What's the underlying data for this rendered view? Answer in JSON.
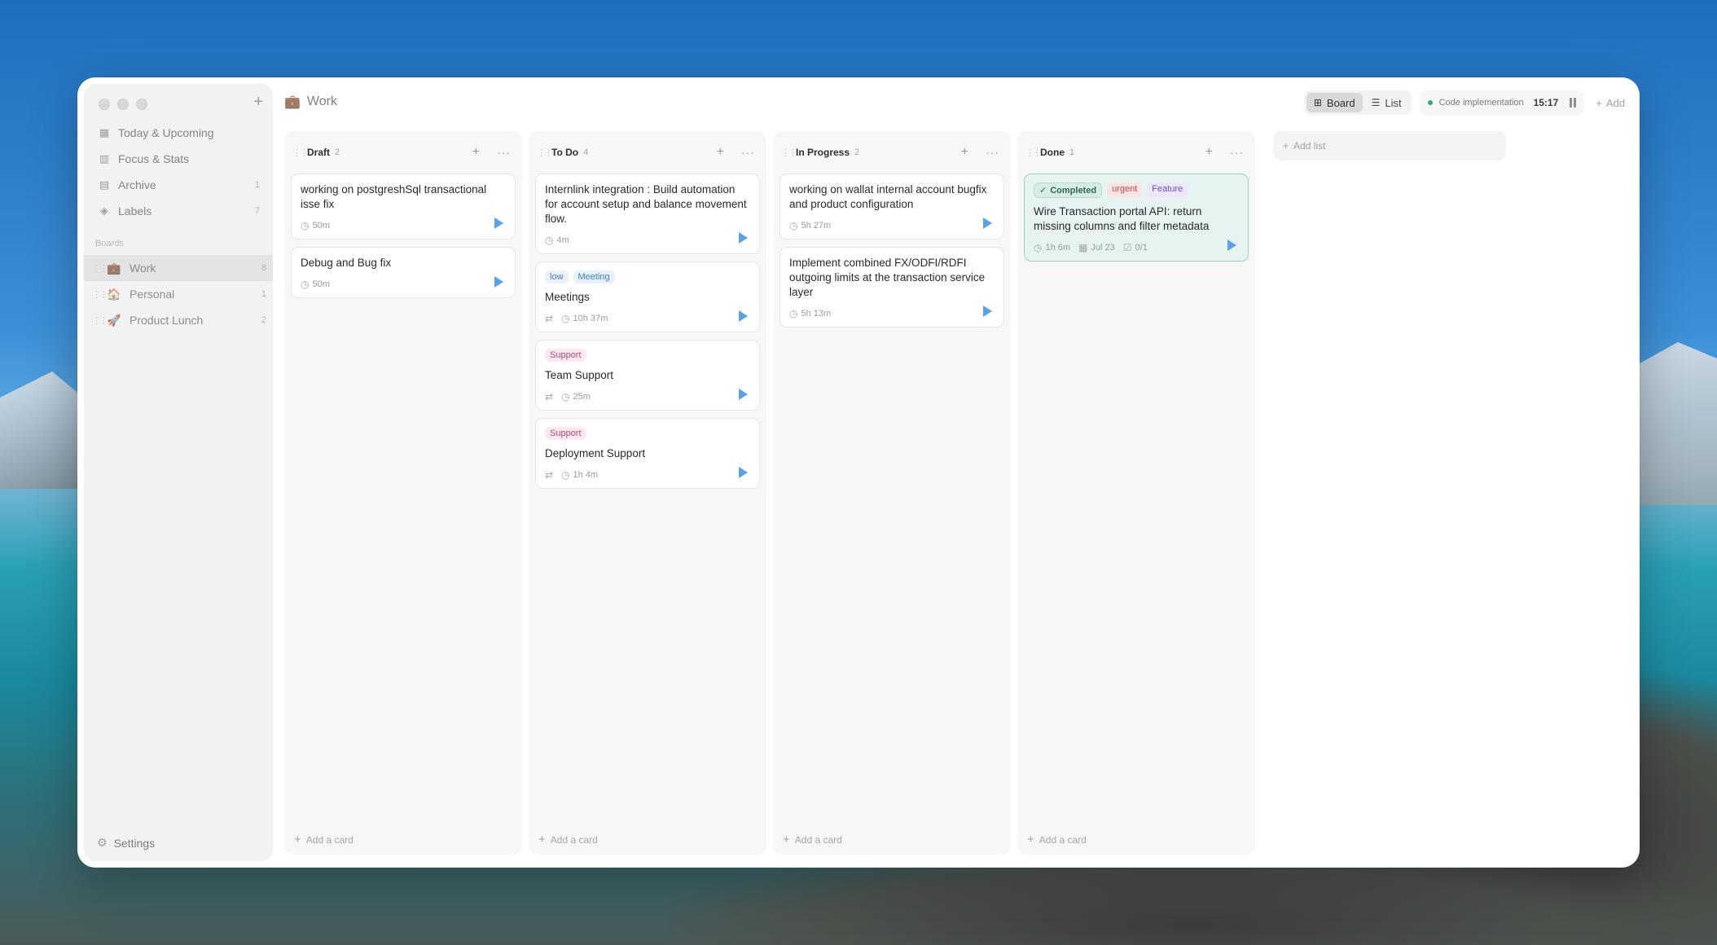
{
  "window": {
    "board_title": "Work",
    "board_emoji": "💼"
  },
  "sidebar": {
    "nav": [
      {
        "label": "Today & Upcoming",
        "icon": "calendar-icon",
        "count": ""
      },
      {
        "label": "Focus & Stats",
        "icon": "chart-icon",
        "count": ""
      },
      {
        "label": "Archive",
        "icon": "archive-icon",
        "count": "1"
      },
      {
        "label": "Labels",
        "icon": "tag-icon",
        "count": "7"
      }
    ],
    "boards_label": "Boards",
    "boards": [
      {
        "label": "Work",
        "emoji": "💼",
        "count": "8",
        "active": true
      },
      {
        "label": "Personal",
        "emoji": "🏠",
        "count": "1",
        "active": false
      },
      {
        "label": "Product Lunch",
        "emoji": "🚀",
        "count": "2",
        "active": false
      }
    ],
    "settings_label": "Settings"
  },
  "toolbar": {
    "board_label": "Board",
    "list_label": "List",
    "timer_task": "Code implementation",
    "timer_time": "15:17",
    "add_label": "Add"
  },
  "lists": [
    {
      "name": "Draft",
      "count": "2",
      "add_card": "Add a card",
      "cards": [
        {
          "title": "working on postgreshSql transactional isse fix",
          "time": "50m",
          "repeat": false,
          "tags": []
        },
        {
          "title": "Debug and Bug fix",
          "time": "50m",
          "repeat": false,
          "tags": []
        }
      ]
    },
    {
      "name": "To Do",
      "count": "4",
      "add_card": "Add a card",
      "cards": [
        {
          "title": "Internlink integration : Build automation for account setup and balance movement flow.",
          "time": "4m",
          "repeat": false,
          "tags": []
        },
        {
          "title": "Meetings",
          "time": "10h 37m",
          "repeat": true,
          "tags": [
            {
              "label": "low",
              "kind": "low"
            },
            {
              "label": "Meeting",
              "kind": "meeting"
            }
          ]
        },
        {
          "title": "Team Support",
          "time": "25m",
          "repeat": true,
          "tags": [
            {
              "label": "Support",
              "kind": "support"
            }
          ]
        },
        {
          "title": "Deployment Support",
          "time": "1h 4m",
          "repeat": true,
          "tags": [
            {
              "label": "Support",
              "kind": "support"
            }
          ]
        }
      ]
    },
    {
      "name": "In Progress",
      "count": "2",
      "add_card": "Add a card",
      "cards": [
        {
          "title": "working on wallat internal account bugfix and product configuration",
          "time": "5h 27m",
          "repeat": false,
          "tags": []
        },
        {
          "title": "Implement combined FX/ODFI/RDFI outgoing limits at the transaction service layer",
          "time": "5h 13m",
          "repeat": false,
          "tags": []
        }
      ]
    },
    {
      "name": "Done",
      "count": "1",
      "add_card": "Add a card",
      "cards": [
        {
          "title": "Wire Transaction portal API: return missing columns and filter metadata",
          "time": "1h 6m",
          "date": "Jul 23",
          "checklist": "0/1",
          "repeat": false,
          "done": true,
          "tags": [
            {
              "label": "Completed",
              "kind": "completed"
            },
            {
              "label": "urgent",
              "kind": "urgent"
            },
            {
              "label": "Feature",
              "kind": "feature"
            }
          ]
        }
      ]
    }
  ],
  "add_list_label": "Add list"
}
